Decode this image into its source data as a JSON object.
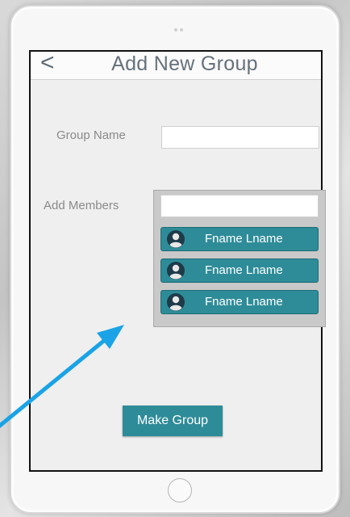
{
  "header": {
    "back_glyph": "<",
    "title": "Add New Group"
  },
  "form": {
    "group_name_label": "Group Name",
    "group_name_value": "",
    "add_members_label": "Add Members",
    "add_members_value": ""
  },
  "members": [
    {
      "name": "Fname Lname",
      "icon": "user-icon"
    },
    {
      "name": "Fname Lname",
      "icon": "user-icon"
    },
    {
      "name": "Fname Lname",
      "icon": "user-icon"
    }
  ],
  "actions": {
    "make_group_label": "Make Group"
  },
  "colors": {
    "accent": "#2e8c98",
    "arrow": "#1aa3e6"
  }
}
